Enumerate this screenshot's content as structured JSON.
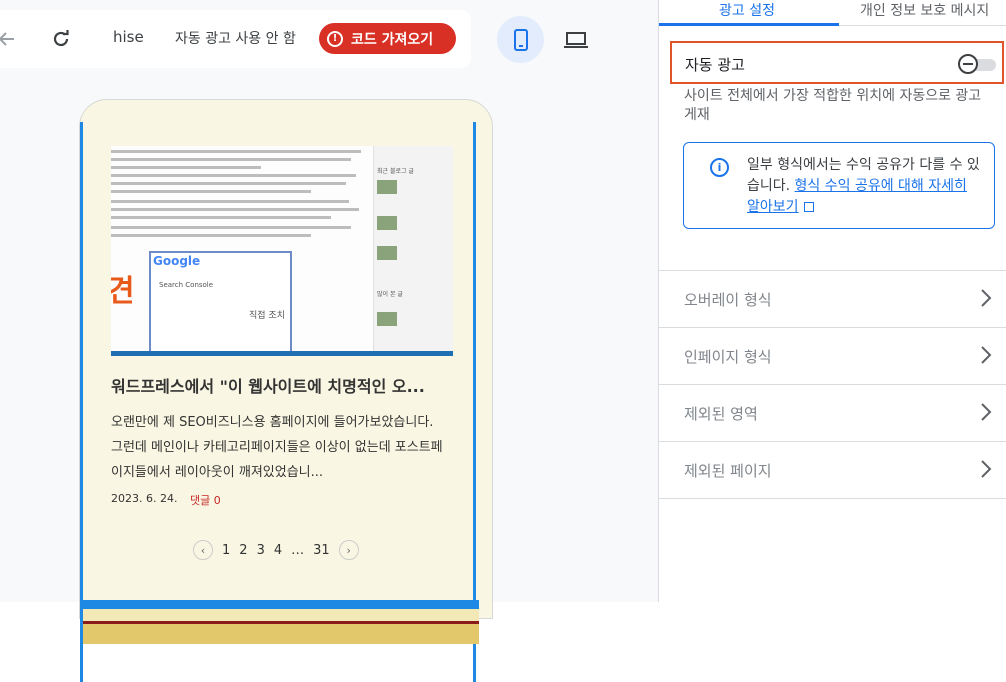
{
  "toolbar": {
    "site_name": "hise",
    "auto_ads_status": "자동 광고 사용 안 함",
    "get_code_label": "코드 가져오기"
  },
  "preview": {
    "screenshot_texts": {
      "logo": "Google",
      "console": "Search Console",
      "side_heading1": "최근 블로그 글",
      "side_heading2": "많이 본 글",
      "big_char": "견",
      "action_label": "직접 조치"
    },
    "post_title": "워드프레스에서 \"이 웹사이트에 치명적인 오...",
    "post_excerpt": "오랜만에 제 SEO비즈니스용 홈페이지에 들어가보았습니다. 그런데 메인이나 카테고리페이지들은 이상이 없는데 포스트페이지들에서 레이아웃이 깨져있었습니...",
    "post_date": "2023. 6. 24.",
    "post_comment": "댓글 0",
    "pager": [
      "1",
      "2",
      "3",
      "4",
      "…",
      "31"
    ]
  },
  "panel": {
    "tabs": [
      "광고 설정",
      "개인 정보 보호 메시지"
    ],
    "auto_ads_label": "자동 광고",
    "auto_ads_description": "사이트 전체에서 가장 적합한 위치에 자동으로 광고 게재",
    "info_text": "일부 형식에서는 수익 공유가 다를 수 있습니다.",
    "info_link": "형식 수익 공유에 대해 자세히 알아보기",
    "rows": [
      "오버레이 형식",
      "인페이지 형식",
      "제외된 영역",
      "제외된 페이지"
    ]
  },
  "colors": {
    "accent": "#1a73e8",
    "danger": "#d93025",
    "highlight_border": "#e0542c",
    "preview_bg": "#f9f7e3"
  }
}
